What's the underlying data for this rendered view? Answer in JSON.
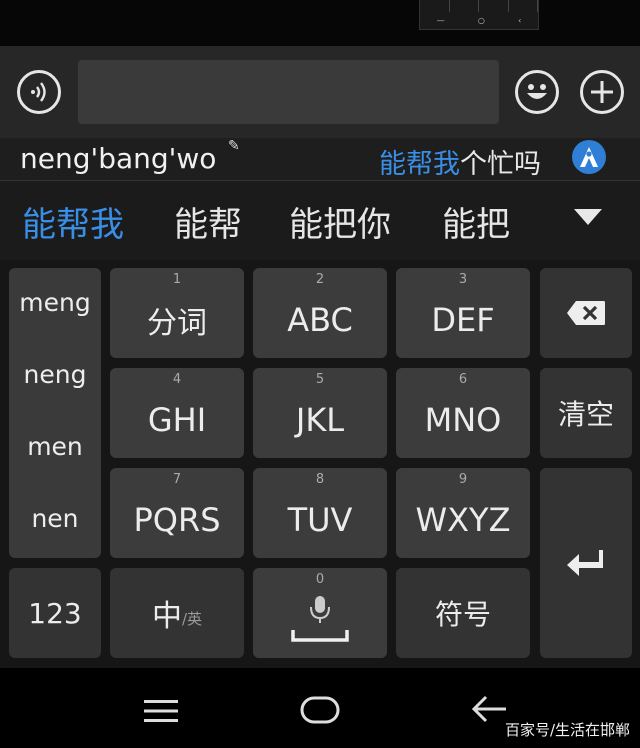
{
  "top_thumbnail": {
    "nav_labels": [
      "—",
      "○",
      "‹"
    ]
  },
  "input_bar": {
    "voice_icon": "voice-waves-icon",
    "emoji_icon": "smiley-icon",
    "plus_icon": "plus-icon",
    "text_value": ""
  },
  "compose": {
    "pinyin": "neng'bang'wo",
    "prediction_highlight": "能帮我",
    "prediction_rest": "个忙吗",
    "accent": "#3a8ee6"
  },
  "candidates": [
    "能帮我",
    "能帮",
    "能把你",
    "能把"
  ],
  "pinyin_options": [
    "meng",
    "neng",
    "men",
    "nen"
  ],
  "keys": {
    "k1": {
      "num": "1",
      "label": "分词"
    },
    "k2": {
      "num": "2",
      "label": "ABC"
    },
    "k3": {
      "num": "3",
      "label": "DEF"
    },
    "k4": {
      "num": "4",
      "label": "GHI"
    },
    "k5": {
      "num": "5",
      "label": "JKL"
    },
    "k6": {
      "num": "6",
      "label": "MNO"
    },
    "k7": {
      "num": "7",
      "label": "PQRS"
    },
    "k8": {
      "num": "8",
      "label": "TUV"
    },
    "k9": {
      "num": "9",
      "label": "WXYZ"
    },
    "k0": {
      "num": "0"
    },
    "clear": "清空",
    "num_switch": "123",
    "lang_main": "中",
    "lang_sub": "/英",
    "symbols": "符号"
  },
  "watermark": "百家号/生活在邯郸"
}
